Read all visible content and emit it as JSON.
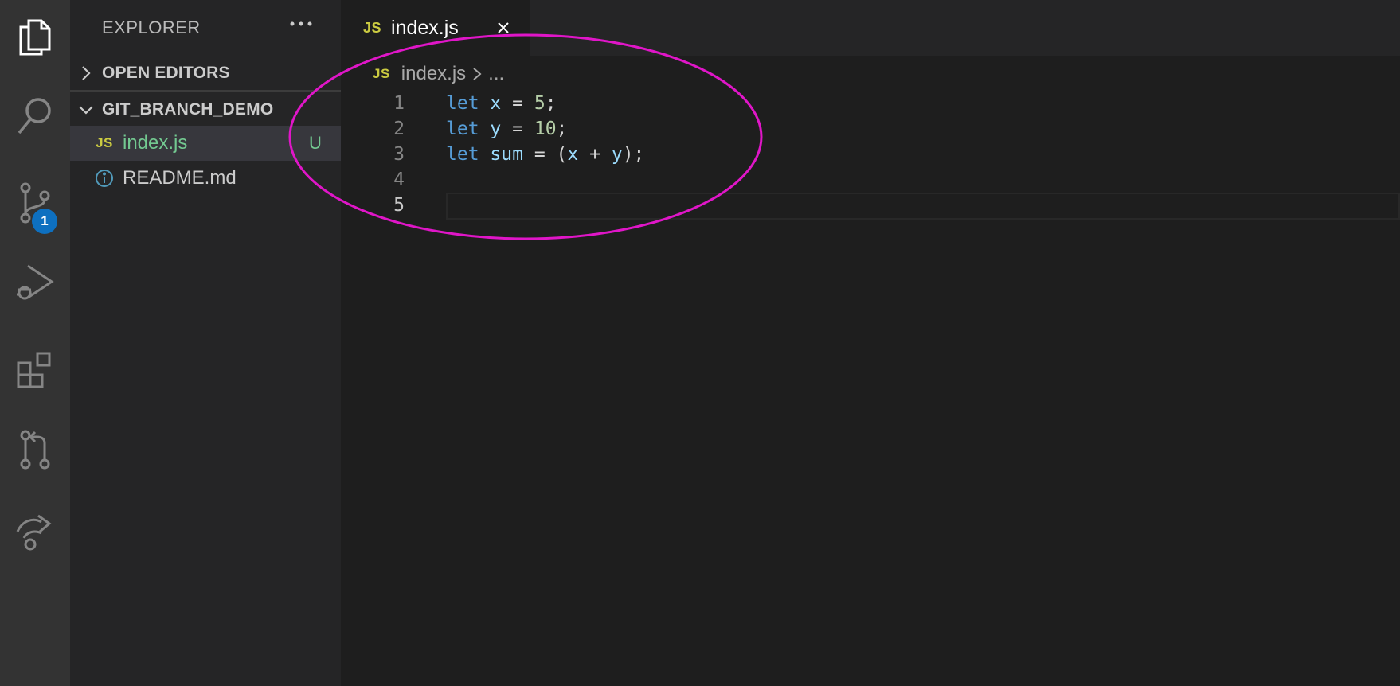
{
  "activity_bar": {
    "items": [
      "explorer-icon",
      "search-icon",
      "source-control-icon",
      "run-debug-icon",
      "extensions-icon",
      "pull-requests-icon",
      "live-share-icon"
    ],
    "source_control_badge": "1"
  },
  "sidebar": {
    "title": "EXPLORER",
    "open_editors_label": "OPEN EDITORS",
    "folder_label": "GIT_BRANCH_DEMO",
    "files": [
      {
        "name": "index.js",
        "icon": "js-file-icon",
        "status": "U",
        "active": true
      },
      {
        "name": "README.md",
        "icon": "info-icon",
        "status": "",
        "active": false
      }
    ]
  },
  "editor": {
    "tab": {
      "label": "index.js",
      "icon_text": "JS"
    },
    "breadcrumb": {
      "file": "index.js",
      "more": "..."
    },
    "current_line": 5,
    "lines": [
      {
        "number": "1"
      },
      {
        "number": "2"
      },
      {
        "number": "3"
      },
      {
        "number": "4"
      },
      {
        "number": "5"
      }
    ],
    "code": {
      "l1": {
        "kw": "let",
        "name": "x",
        "eq": "=",
        "val": "5",
        "end": ";"
      },
      "l2": {
        "kw": "let",
        "name": "y",
        "eq": "=",
        "val": "10",
        "end": ";"
      },
      "l3": {
        "kw": "let",
        "name": "sum",
        "eq": "=",
        "open": "(",
        "a": "x",
        "plus": "+",
        "b": "y",
        "close": ");"
      }
    }
  },
  "colors": {
    "annotation": "#e016c8",
    "keyword": "#569cd6",
    "variable": "#9cdcfe",
    "number": "#b5cea8",
    "untracked": "#73c991",
    "js_icon": "#cbcb41",
    "badge": "#0e70c0"
  },
  "js_icon_text": "JS"
}
